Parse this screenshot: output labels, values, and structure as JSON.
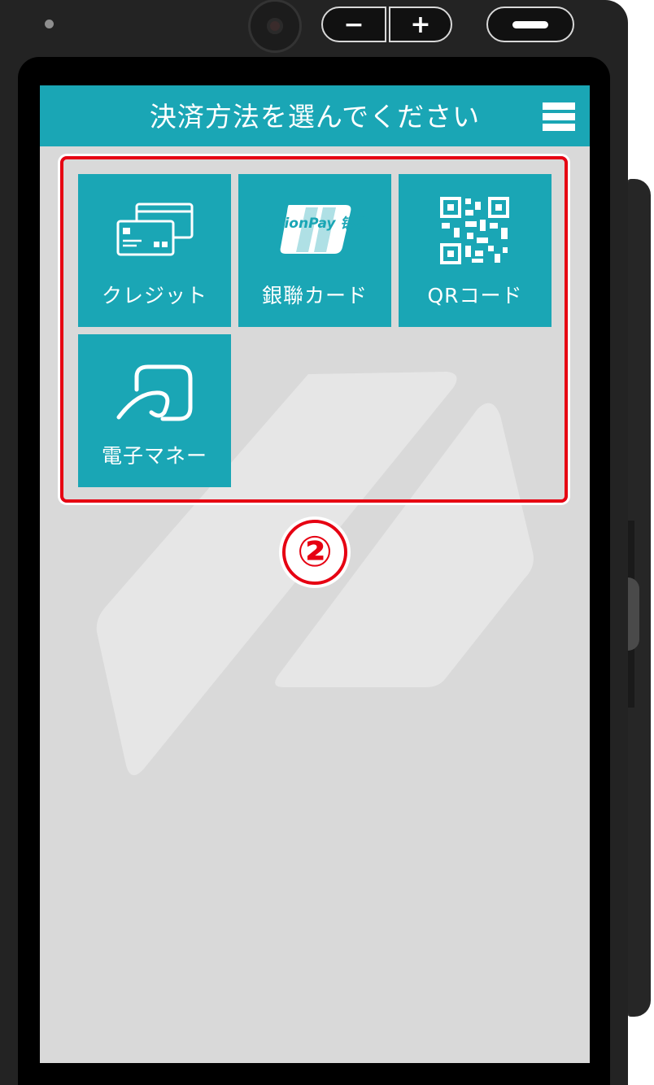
{
  "header": {
    "title": "決済方法を選んでください",
    "menu_icon": "hamburger-menu-icon"
  },
  "payment_methods": [
    {
      "label": "クレジット",
      "icon": "credit-card-icon"
    },
    {
      "label": "銀聯カード",
      "icon": "unionpay-logo-icon",
      "logo_text": "UnionPay 银联"
    },
    {
      "label": "QRコード",
      "icon": "qr-code-icon"
    },
    {
      "label": "電子マネー",
      "icon": "contactless-emoney-icon"
    }
  ],
  "annotation": {
    "step_marker": "②"
  },
  "colors": {
    "accent": "#1aa6b5",
    "screen_background": "#d9d9d9",
    "highlight": "#e60012",
    "device": "#232323"
  }
}
